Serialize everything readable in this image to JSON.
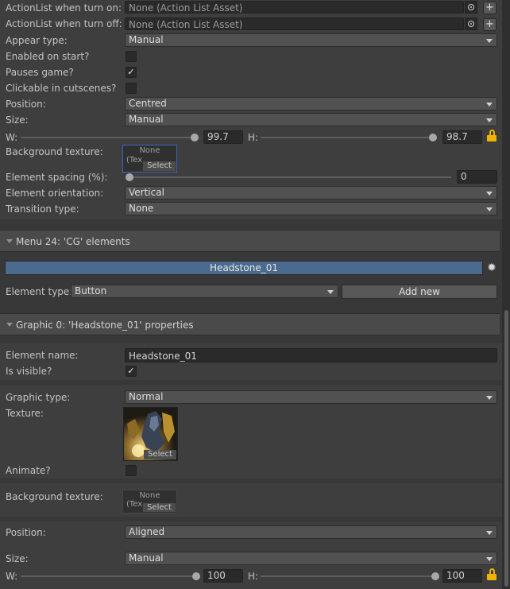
{
  "top": {
    "actionlist_on": {
      "label": "ActionList when turn on:",
      "value": "None (Action List Asset)"
    },
    "actionlist_off": {
      "label": "ActionList when turn off:",
      "value": "None (Action List Asset)"
    },
    "appear_type": {
      "label": "Appear type:",
      "value": "Manual"
    },
    "enabled_on_start": {
      "label": "Enabled on start?",
      "checked": false
    },
    "pauses_game": {
      "label": "Pauses game?",
      "checked": true
    },
    "clickable_cutscenes": {
      "label": "Clickable in cutscenes?",
      "checked": false
    },
    "position": {
      "label": "Position:",
      "value": "Centred"
    },
    "size": {
      "label": "Size:",
      "value": "Manual"
    },
    "w": {
      "label": "W:",
      "value": "99.7"
    },
    "h": {
      "label": "H:",
      "value": "98.7"
    },
    "bg_texture": {
      "label": "Background texture:",
      "slot_none": "None",
      "slot_tex": "(Tex",
      "slot_select": "Select"
    },
    "element_spacing": {
      "label": "Element spacing (%):",
      "value": "0"
    },
    "element_orientation": {
      "label": "Element orientation:",
      "value": "Vertical"
    },
    "transition_type": {
      "label": "Transition type:",
      "value": "None"
    }
  },
  "menu_header": "Menu 24: 'CG' elements",
  "element_bar": {
    "label": "Headstone_01"
  },
  "element_type": {
    "label": "Element type:",
    "value": "Button",
    "add_new": "Add new"
  },
  "graphic_header": "Graphic 0: 'Headstone_01' properties",
  "graphic": {
    "element_name": {
      "label": "Element name:",
      "value": "Headstone_01"
    },
    "is_visible": {
      "label": "Is visible?",
      "checked": true
    },
    "graphic_type": {
      "label": "Graphic type:",
      "value": "Normal"
    },
    "texture": {
      "label": "Texture:",
      "select": "Select"
    },
    "animate": {
      "label": "Animate?",
      "checked": false
    },
    "bg_texture": {
      "label": "Background texture:",
      "slot_none": "None",
      "slot_tex": "(Tex",
      "slot_select": "Select"
    },
    "position": {
      "label": "Position:",
      "value": "Aligned"
    },
    "size": {
      "label": "Size:",
      "value": "Manual"
    },
    "w": {
      "label": "W:",
      "value": "100"
    },
    "h": {
      "label": "H:",
      "value": "100"
    }
  },
  "colors": {
    "accent_bar": "#4a6a8e",
    "lock": "#f0b400"
  },
  "icons": [
    "object-picker-icon",
    "plus-icon",
    "dropdown-arrow-icon",
    "checkmark-icon",
    "lock-icon",
    "gear-icon",
    "foldout-arrow-icon"
  ]
}
